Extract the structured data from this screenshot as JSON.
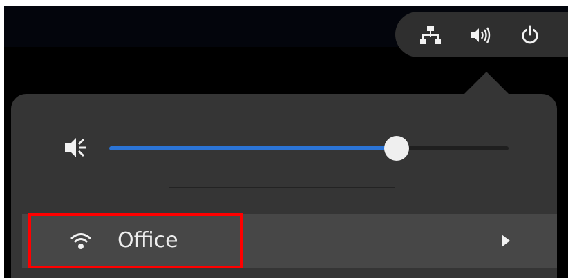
{
  "top_panel": {
    "status_icons": [
      {
        "icon": "network-wired-icon"
      },
      {
        "icon": "speaker-volume-icon"
      },
      {
        "icon": "power-icon"
      }
    ]
  },
  "popover": {
    "volume": {
      "icon": "speaker-low-icon",
      "level": 0.72
    },
    "network_item": {
      "icon": "wifi-icon",
      "label": "Office",
      "submenu_icon": "triangle-right-icon"
    }
  },
  "colors": {
    "accent": "#2b74d6",
    "highlight_border": "#ff0000",
    "menu_background": "#353535",
    "selected_row": "#474747"
  }
}
